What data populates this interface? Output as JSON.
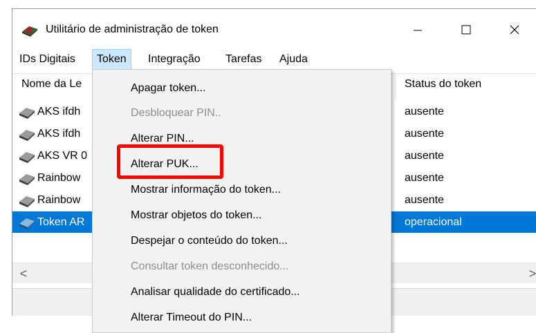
{
  "window": {
    "title": "Utilitário de administração de token",
    "controls": {
      "minimize": "minimize",
      "maximize": "maximize",
      "close": "close"
    }
  },
  "menubar": {
    "items": [
      {
        "label": "IDs Digitais"
      },
      {
        "label": "Token"
      },
      {
        "label": "Integração"
      },
      {
        "label": "Tarefas"
      },
      {
        "label": "Ajuda"
      }
    ]
  },
  "list": {
    "headers": {
      "name": "Nome da Le",
      "status": "Status do token"
    },
    "rows": [
      {
        "name": "AKS ifdh",
        "status": "ausente",
        "icon": "drive-icon"
      },
      {
        "name": "AKS ifdh",
        "status": "ausente",
        "icon": "drive-icon"
      },
      {
        "name": "AKS VR 0",
        "status": "ausente",
        "icon": "drive-icon"
      },
      {
        "name": "Rainbow",
        "status": "ausente",
        "icon": "drive-icon"
      },
      {
        "name": "Rainbow",
        "status": "ausente",
        "icon": "drive-icon"
      },
      {
        "name": "Token AR",
        "status": "operacional",
        "icon": "drive-icon",
        "selected": true
      }
    ]
  },
  "token_menu": {
    "items": [
      {
        "label": "Apagar token...",
        "enabled": true
      },
      {
        "label": "Desbloquear PIN..",
        "enabled": false
      },
      {
        "label": "Alterar PIN...",
        "enabled": true
      },
      {
        "label": "Alterar PUK...",
        "enabled": true,
        "highlighted": true
      },
      {
        "label": "Mostrar informação do token...",
        "enabled": true
      },
      {
        "label": "Mostrar objetos do token...",
        "enabled": true
      },
      {
        "label": "Despejar o conteúdo do token...",
        "enabled": true
      },
      {
        "label": "Consultar token desconhecido...",
        "enabled": false
      },
      {
        "label": "Analisar qualidade do certificado...",
        "enabled": true
      },
      {
        "label": "Alterar Timeout do PIN...",
        "enabled": true
      }
    ]
  },
  "scrollbar": {
    "left_arrow": "<",
    "right_arrow": ">"
  },
  "colors": {
    "selection": "#0078d7",
    "menu_active": "#cce8ff",
    "highlight_box": "#ff0000",
    "disabled_text": "#8d8d8d"
  }
}
